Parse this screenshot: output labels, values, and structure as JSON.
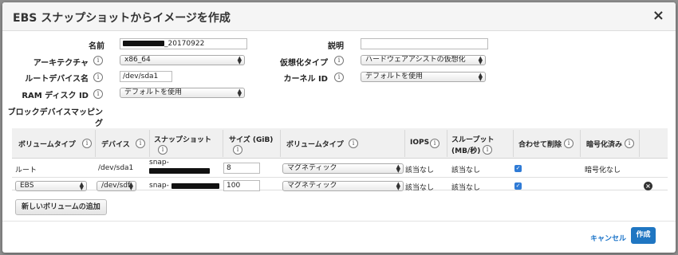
{
  "dialog": {
    "title": "EBS スナップショットからイメージを作成",
    "close": "×"
  },
  "info_glyph": "i",
  "form": {
    "name": {
      "label": "名前",
      "value_suffix": "_20170922"
    },
    "description": {
      "label": "説明",
      "value": ""
    },
    "architecture": {
      "label": "アーキテクチャ",
      "value": "x86_64"
    },
    "virtualization": {
      "label": "仮想化タイプ",
      "value": "ハードウェアアシストの仮想化"
    },
    "root_device": {
      "label": "ルートデバイス名",
      "value": "/dev/sda1"
    },
    "kernel": {
      "label": "カーネル ID",
      "value": "デフォルトを使用"
    },
    "ramdisk": {
      "label": "RAM ディスク ID",
      "value": "デフォルトを使用"
    },
    "block_device": {
      "label_line1": "ブロックデバイスマッピン",
      "label_line2": "グ"
    }
  },
  "table": {
    "headers": {
      "volume_type": "ボリュームタイプ",
      "device": "デバイス",
      "snapshot": "スナップショット",
      "size": "サイズ (GiB)",
      "ebs_volume_type": "ボリュームタイプ",
      "iops": "IOPS",
      "throughput_line1": "スループット",
      "throughput_line2": "(MB/秒)",
      "delete": "合わせて削除",
      "encrypted": "暗号化済み"
    },
    "rows": [
      {
        "volume_type": "ルート",
        "device": "/dev/sda1",
        "snapshot_prefix": "snap-",
        "size": "8",
        "ebs_volume_type": "マグネティック",
        "iops": "該当なし",
        "throughput": "該当なし",
        "delete_on_termination": true,
        "encrypted": "暗号化なし"
      },
      {
        "volume_type": "EBS",
        "device": "/dev/sdf",
        "snapshot_prefix": "snap-",
        "size": "100",
        "ebs_volume_type": "マグネティック",
        "iops": "該当なし",
        "throughput": "該当なし",
        "delete_on_termination": true,
        "encrypted": ""
      }
    ]
  },
  "buttons": {
    "add_volume": "新しいボリュームの追加",
    "cancel": "キャンセル",
    "create": "作成"
  },
  "icons": {
    "check": "✓",
    "remove": "×",
    "select_arrow_up": "▲",
    "select_arrow_down": "▼"
  },
  "colors": {
    "primary_button": "#1f76c2",
    "link": "#1a73c8",
    "checkbox": "#2f7bd6"
  }
}
